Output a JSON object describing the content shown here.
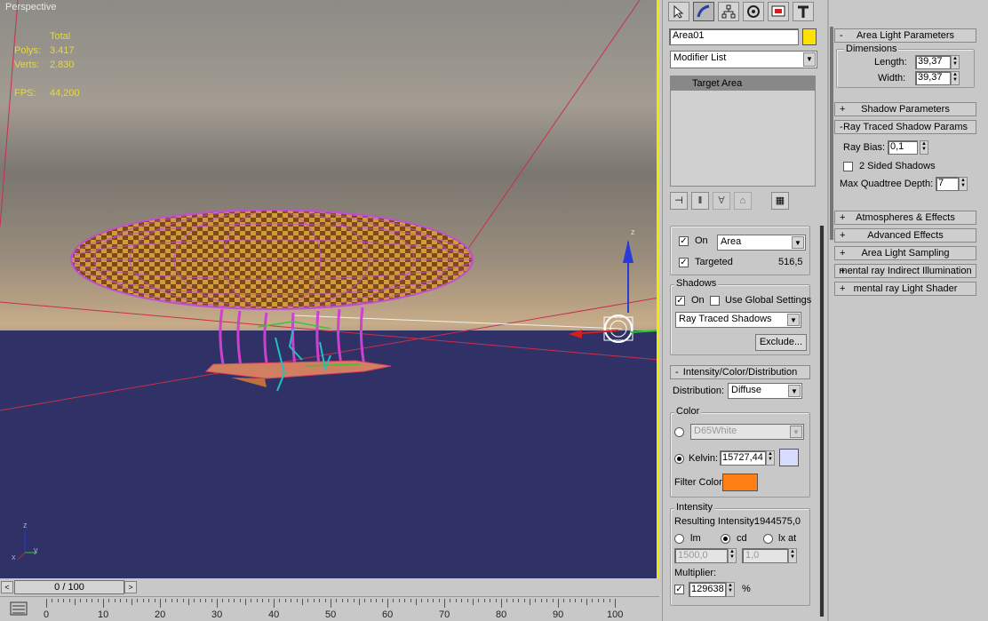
{
  "viewport": {
    "label": "Perspective",
    "stats": {
      "total_label": "Total",
      "polys_label": "Polys:",
      "polys_value": "3.417",
      "verts_label": "Verts:",
      "verts_value": "2.830",
      "fps_label": "FPS:",
      "fps_value": "44,200"
    },
    "axis": {
      "x": "x",
      "y": "y",
      "z": "z"
    },
    "gizmo_z": "z"
  },
  "timeline": {
    "slider_text": "0 / 100",
    "prev": "<",
    "next": ">",
    "ticks": [
      "0",
      "10",
      "20",
      "30",
      "40",
      "50",
      "60",
      "70",
      "80",
      "90",
      "100"
    ]
  },
  "cmdpanel": {
    "tabs": [
      "create-icon",
      "modify-icon",
      "hierarchy-icon",
      "motion-icon",
      "display-icon",
      "utilities-icon"
    ],
    "object_name": "Area01",
    "object_color": "#ffe000",
    "modifier_list": "Modifier List",
    "stack_item": "Target Area",
    "general": {
      "on_label": "On",
      "on_checked": "✓",
      "type_value": "Area",
      "targeted_label": "Targeted",
      "targeted_checked": "✓",
      "targeted_value": "516,5"
    },
    "shadows": {
      "title": "Shadows",
      "on_label": "On",
      "on_checked": "✓",
      "global_label": "Use Global Settings",
      "type_value": "Ray Traced Shadows",
      "exclude_label": "Exclude..."
    },
    "intensity_rollout": {
      "title": "Intensity/Color/Distribution",
      "sign": "-",
      "distribution_label": "Distribution:",
      "distribution_value": "Diffuse",
      "color_title": "Color",
      "preset_value": "D65White",
      "kelvin_label": "Kelvin:",
      "kelvin_value": "15727,44",
      "kelvin_color": "#d8dcff",
      "filter_label": "Filter Color:",
      "filter_color": "#ff7f17",
      "intensity_title": "Intensity",
      "resulting_label": "Resulting Intensity:",
      "resulting_value": "1944575,0",
      "lm_label": "lm",
      "cd_label": "cd",
      "lx_label": "lx at",
      "lm_value": "1500,0",
      "lx_value": "1,0",
      "multiplier_label": "Multiplier:",
      "multiplier_checked": "✓",
      "multiplier_value": "129638",
      "multiplier_unit": "%"
    }
  },
  "rightpanel": {
    "area_light": {
      "title": "Area Light Parameters",
      "sign": "-",
      "dimensions_title": "Dimensions",
      "length_label": "Length:",
      "length_value": "39,37",
      "width_label": "Width:",
      "width_value": "39,37"
    },
    "shadow_params": {
      "title": "Shadow Parameters",
      "sign": "+"
    },
    "ray_traced": {
      "title": "Ray Traced Shadow Params",
      "sign": "-",
      "bias_label": "Ray Bias:",
      "bias_value": "0,1",
      "two_sided_label": "2 Sided Shadows",
      "depth_label": "Max Quadtree Depth:",
      "depth_value": "7"
    },
    "rollouts": [
      {
        "sign": "+",
        "title": "Atmospheres & Effects"
      },
      {
        "sign": "+",
        "title": "Advanced Effects"
      },
      {
        "sign": "+",
        "title": "Area Light Sampling"
      },
      {
        "sign": "+",
        "title": "mental ray Indirect Illumination"
      },
      {
        "sign": "+",
        "title": "mental ray Light Shader"
      }
    ]
  }
}
